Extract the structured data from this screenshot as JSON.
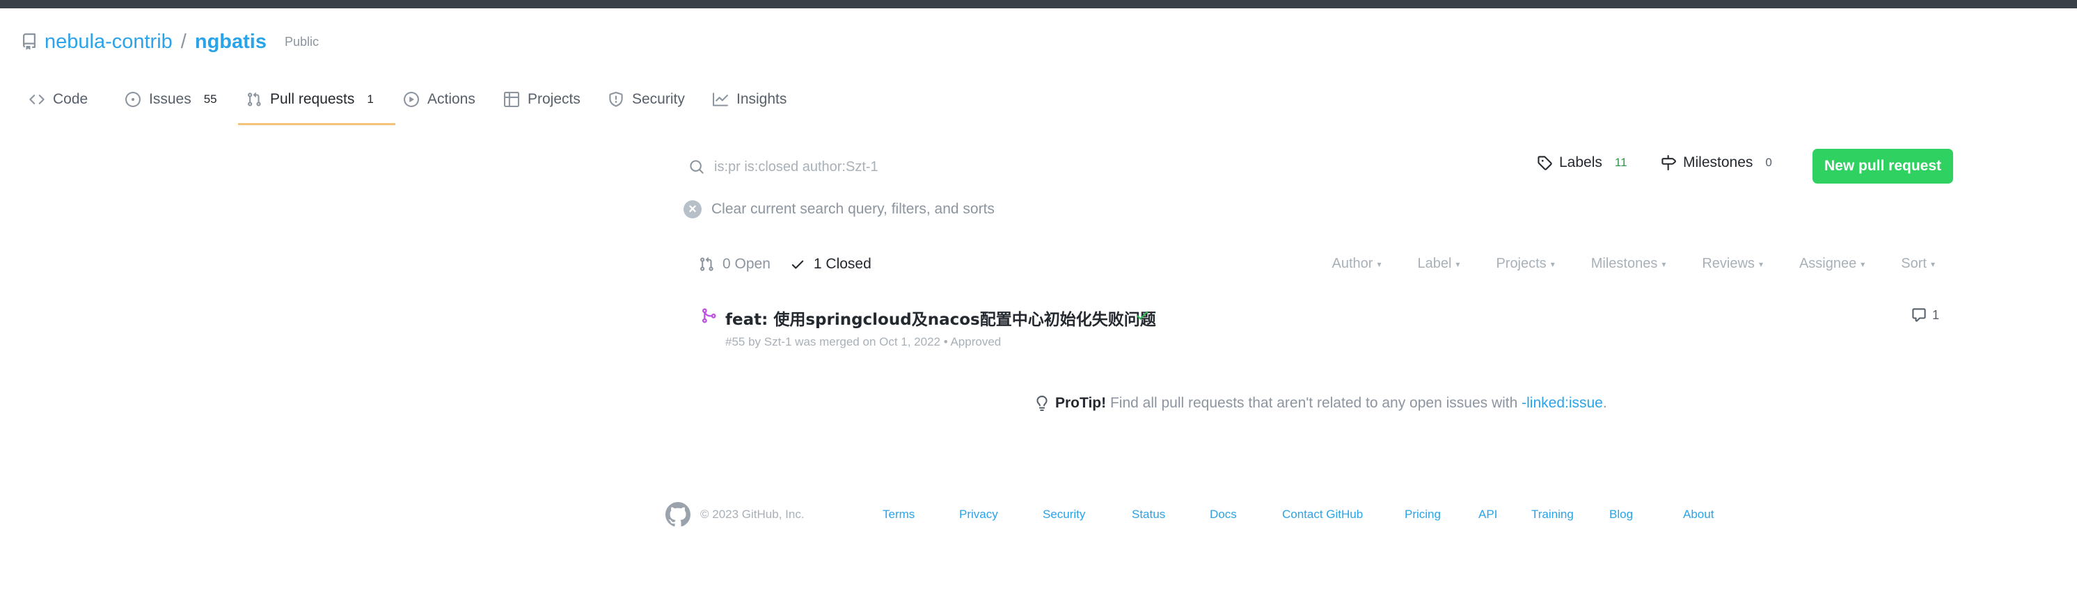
{
  "repo": {
    "owner": "nebula-contrib",
    "separator": "/",
    "name": "ngbatis",
    "visibility": "Public"
  },
  "tabs": [
    {
      "label": "Code",
      "icon": "code-icon"
    },
    {
      "label": "Issues",
      "icon": "issue-opened-icon",
      "count": "55"
    },
    {
      "label": "Pull requests",
      "icon": "git-pull-request-icon",
      "count": "1",
      "selected": true
    },
    {
      "label": "Actions",
      "icon": "play-icon"
    },
    {
      "label": "Projects",
      "icon": "table-icon"
    },
    {
      "label": "Security",
      "icon": "shield-icon"
    },
    {
      "label": "Insights",
      "icon": "graph-icon"
    }
  ],
  "search": {
    "placeholder": "is:pr is:closed author:Szt-1"
  },
  "labels": {
    "label": "Labels",
    "count": "11"
  },
  "milestones": {
    "label": "Milestones",
    "count": "0"
  },
  "new_pr": {
    "label": "New pull request"
  },
  "clear_query": {
    "label": "Clear current search query, filters, and sorts"
  },
  "states": {
    "open": "0 Open",
    "closed": "1 Closed"
  },
  "filters": [
    "Author",
    "Label",
    "Projects",
    "Milestones",
    "Reviews",
    "Assignee",
    "Sort"
  ],
  "pull_request": {
    "title": "feat: 使用springcloud及nacos配置中心初始化失败问题",
    "meta": "#55 by Szt-1 was merged on Oct 1, 2022 • Approved",
    "comments": "1",
    "status_color": "#bf4fe3"
  },
  "protip": {
    "lead": "ProTip!",
    "text": " Find all pull requests that aren't related to any open issues with ",
    "link": "-linked:issue",
    "tail": "."
  },
  "footer": {
    "copyright": "© 2023 GitHub, Inc.",
    "links": [
      "Terms",
      "Privacy",
      "Security",
      "Status",
      "Docs",
      "Contact GitHub",
      "Pricing",
      "API",
      "Training",
      "Blog",
      "About"
    ]
  },
  "colors": {
    "accent_link": "#2aa3e8",
    "primary_button": "#2fd160",
    "merged": "#bf4fe3",
    "approved_check": "#2fb85a"
  }
}
